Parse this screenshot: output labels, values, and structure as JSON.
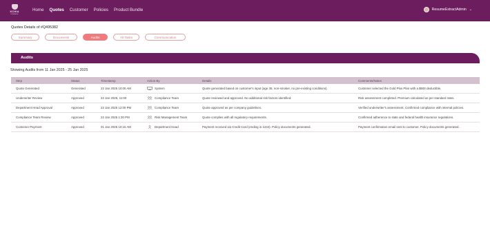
{
  "nav": {
    "logo_text": "XCHIA",
    "logo_sub": "Insurance",
    "links": [
      "Home",
      "Quotes",
      "Customer",
      "Policies",
      "Product Bundle"
    ],
    "active": "Quotes",
    "user_name": "ResumeExtractAdmin",
    "caret": "⌄"
  },
  "page": {
    "quote_title": "Quotes Details of #Q495382",
    "tabs": [
      "Summary",
      "Documents",
      "Audits",
      "All Tasks",
      "Communication"
    ],
    "active_tab": "Audits"
  },
  "audits": {
    "title": "Audits",
    "showing_text": "Showing Audits from 11 Jan 2025 - 25 Jan 2025",
    "columns": [
      "Step",
      "Status",
      "Timestamp",
      "Action By",
      "Details",
      "Comments/Notes"
    ],
    "rows": [
      [
        "Quote Generated",
        "Generated",
        "22 Jan 2025 10:00 AM",
        "System",
        "Quote generated based on customer's input (age 35, non-smoker, no pre-existing conditions).",
        "Customer selected the Gold Plus Plan with a $500 deductible."
      ],
      [
        "Underwriter Review",
        "Approved",
        "22 Jan 2025, 11:00",
        "Compliance Team",
        "Quote reviewed and approved. No additional risk factors identified.",
        "Risk assessment completed. Premium calculated as per standard rates."
      ],
      [
        "Department Head Approval",
        "Approved",
        "22 Jan 2025 12:00 PM",
        "Compliance Team",
        "Quote approved as per company guidelines.",
        "Verified underwriter's assessment. Confirmed compliance with internal policies."
      ],
      [
        "Compliance Team Review",
        "Approved",
        "22 Jan 2025 1:30 PM",
        "Risk Management Team",
        "Quote complies with all regulatory requirements.",
        "Confirmed adherence to state and federal health insurance regulations."
      ],
      [
        "Customer Payment",
        "Approved",
        "01 Jan 2025 10:15 AM",
        "Department Head",
        "Payment received via Credit Card (ending in 1234). Policy documents generated.",
        "Payment confirmation email sent to customer. Policy documents generated."
      ]
    ],
    "actor_icons": [
      "monitor-icon",
      "team-icon",
      "team-icon",
      "team-icon",
      "user-icon"
    ]
  }
}
